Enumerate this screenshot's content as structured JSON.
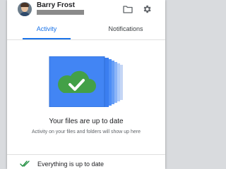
{
  "user": {
    "name": "Barry Frost"
  },
  "tabs": [
    {
      "label": "Activity"
    },
    {
      "label": "Notifications"
    }
  ],
  "empty_state": {
    "title": "Your files are up to date",
    "subtitle": "Activity on your files and folders will show up here"
  },
  "status": {
    "text": "Everything is up to date"
  },
  "colors": {
    "accent": "#1a73e8",
    "cloud_green": "#43a047",
    "folder_blue": "#4285f4"
  },
  "icons": {
    "folder": "folder-icon",
    "settings": "gear-icon",
    "status": "double-check-icon"
  }
}
